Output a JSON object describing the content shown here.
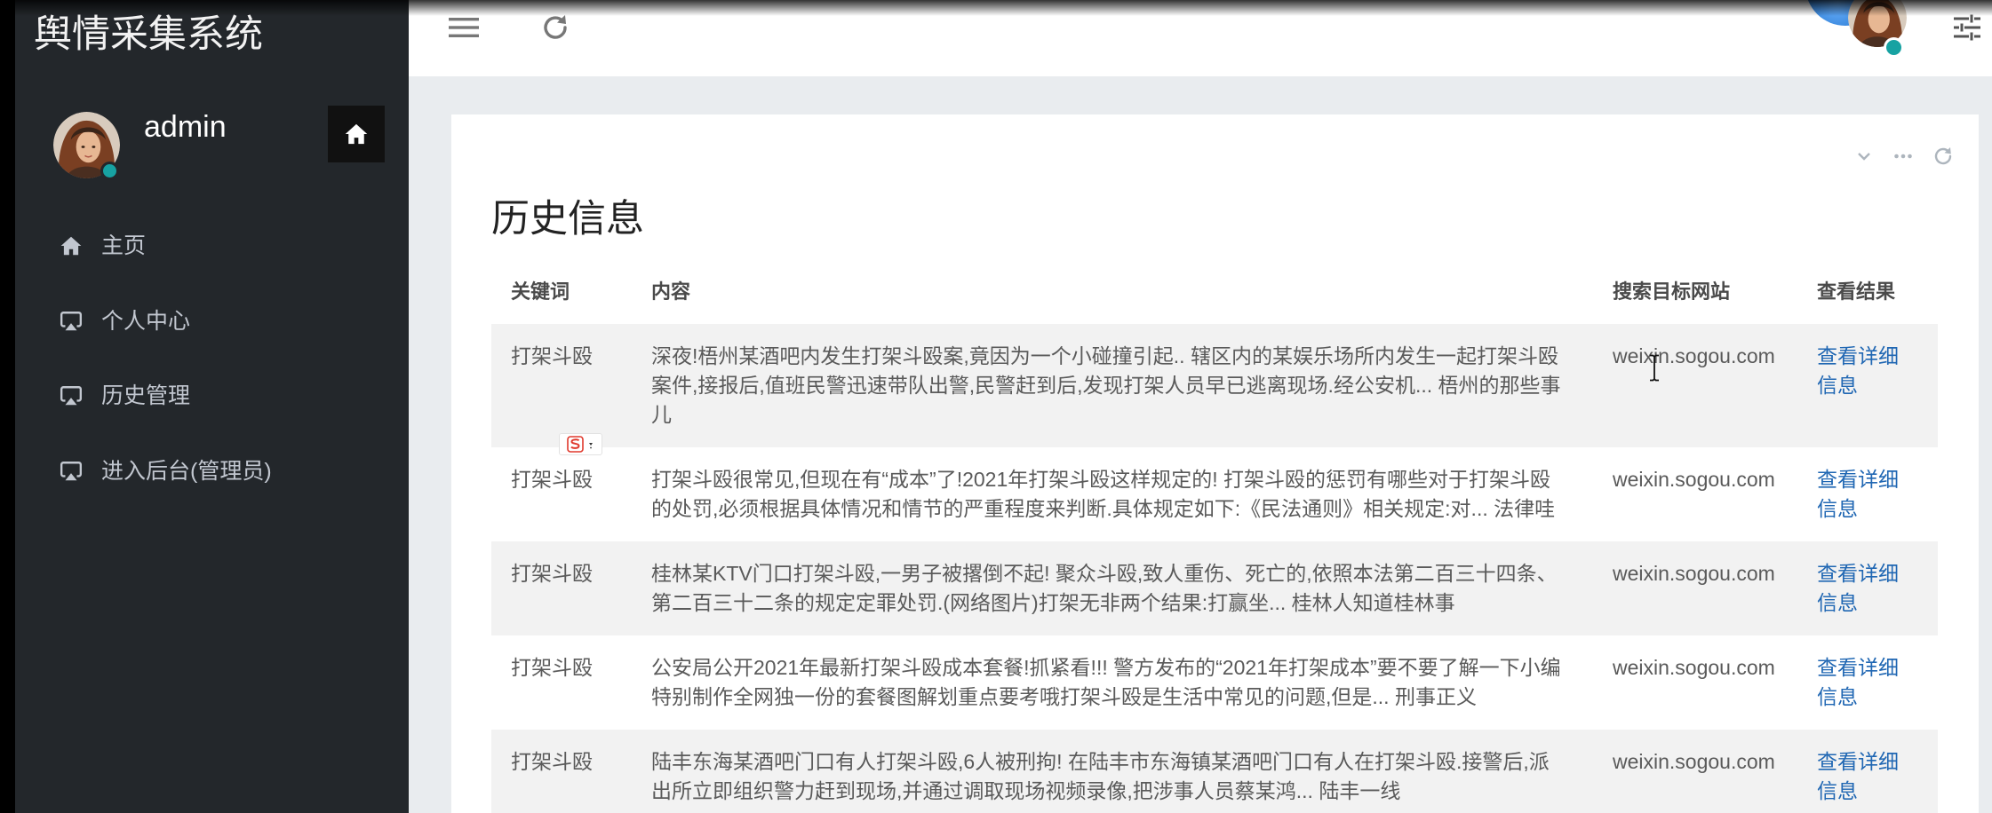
{
  "app": {
    "title": "舆情采集系统"
  },
  "colors": {
    "sidebar_bg": "#23272b",
    "page_bg": "#e9ecef",
    "link": "#2067b3",
    "status": "#17a2a2",
    "stripe": "#f2f2f2"
  },
  "sidebar": {
    "user": {
      "name": "admin",
      "avatar_icon": "user-avatar"
    },
    "home_button": {
      "icon": "home-icon"
    },
    "menu": [
      {
        "label": "主页",
        "icon": "home-icon"
      },
      {
        "label": "个人中心",
        "icon": "airplay-icon"
      },
      {
        "label": "历史管理",
        "icon": "airplay-icon"
      },
      {
        "label": "进入后台(管理员)",
        "icon": "airplay-icon"
      }
    ]
  },
  "topbar": {
    "left_icons": [
      "hamburger-icon",
      "refresh-icon"
    ],
    "right_icons": [
      "user-avatar",
      "sliders-icon"
    ]
  },
  "card": {
    "title": "历史信息",
    "tools": [
      "chevron-down-icon",
      "ellipsis-icon",
      "refresh-icon"
    ],
    "table": {
      "columns": [
        "关键词",
        "内容",
        "搜索目标网站",
        "查看结果"
      ],
      "rows": [
        {
          "keyword": "打架斗殴",
          "content": "深夜!梧州某酒吧内发生打架斗殴案,竟因为一个小碰撞引起.. 辖区内的某娱乐场所内发生一起打架斗殴案件,接报后,值班民警迅速带队出警,民警赶到后,发现打架人员早已逃离现场.经公安机... 梧州的那些事儿",
          "site": "weixin.sogou.com",
          "action": "查看详细信息"
        },
        {
          "keyword": "打架斗殴",
          "content": "打架斗殴很常见,但现在有“成本”了!2021年打架斗殴这样规定的! 打架斗殴的惩罚有哪些对于打架斗殴的处罚,必须根据具体情况和情节的严重程度来判断.具体规定如下:《民法通则》相关规定:对... 法律哇",
          "site": "weixin.sogou.com",
          "action": "查看详细信息"
        },
        {
          "keyword": "打架斗殴",
          "content": "桂林某KTV门口打架斗殴,一男子被撂倒不起! 聚众斗殴,致人重伤、死亡的,依照本法第二百三十四条、第二百三十二条的规定定罪处罚.(网络图片)打架无非两个结果:打赢坐... 桂林人知道桂林事",
          "site": "weixin.sogou.com",
          "action": "查看详细信息"
        },
        {
          "keyword": "打架斗殴",
          "content": "公安局公开2021年最新打架斗殴成本套餐!抓紧看!!! 警方发布的“2021年打架成本”要不要了解一下小编特别制作全网独一份的套餐图解划重点要考哦打架斗殴是生活中常见的问题,但是... 刑事正义",
          "site": "weixin.sogou.com",
          "action": "查看详细信息"
        },
        {
          "keyword": "打架斗殴",
          "content": "陆丰东海某酒吧门口有人打架斗殴,6人被刑拘! 在陆丰市东海镇某酒吧门口有人在打架斗殴.接警后,派出所立即组织警力赶到现场,并通过调取现场视频录像,把涉事人员蔡某鸿... 陆丰一线",
          "site": "weixin.sogou.com",
          "action": "查看详细信息"
        }
      ]
    }
  },
  "overlays": {
    "ime_icon": "sogou-ime-icon",
    "cursor_icon": "i-beam-cursor-icon"
  }
}
